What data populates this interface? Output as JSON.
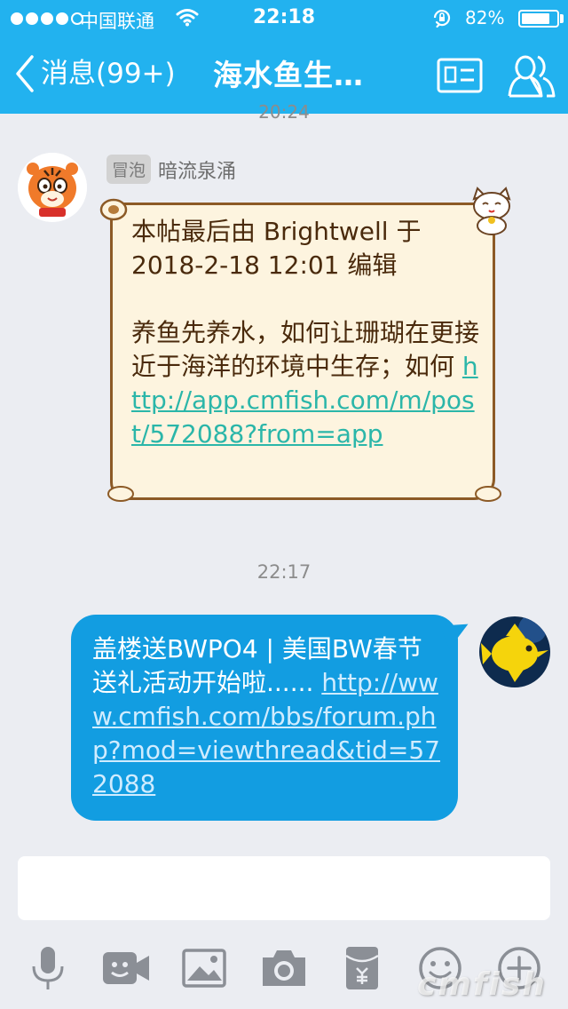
{
  "status_bar": {
    "carrier": "中国联通",
    "time": "22:18",
    "battery_pct": "82%",
    "battery_level": 0.82,
    "signal_filled": 4,
    "signal_total": 5
  },
  "nav": {
    "back_label": "消息(99+)",
    "title": "海水鱼生…",
    "icons": [
      "chevron-left-icon",
      "profile-card-icon",
      "group-members-icon"
    ]
  },
  "chat": {
    "partial_timestamp": "20:24",
    "incoming": {
      "sender_badge": "冒泡",
      "sender_name": "暗流泉涌",
      "avatar": "tiger-avatar",
      "line1": "本帖最后由 Brightwell 于 2018-2-18 12:01 编辑",
      "line2": "养鱼先养水，如何让珊瑚在更接近于海洋的环境中生存；如何",
      "link": "http://app.cmfish.com/m/post/572088?from=app"
    },
    "timestamp": "22:17",
    "outgoing": {
      "text": "盖楼送BWPO4 | 美国BW春节送礼活动开始啦......",
      "link": "http://www.cmfish.com/bbs/forum.php?mod=viewthread&tid=572088",
      "avatar": "yellow-fish-avatar"
    }
  },
  "input": {
    "placeholder": ""
  },
  "toolbar": {
    "items": [
      "microphone-icon",
      "video-call-icon",
      "image-icon",
      "camera-icon",
      "red-packet-icon",
      "emoji-icon",
      "plus-icon"
    ]
  },
  "watermark": "cmfish",
  "colors": {
    "header": "#22b2ef",
    "background": "#ebedf2",
    "outgoing_bubble": "#129de1",
    "incoming_bubble": "#fdf4df",
    "incoming_border": "#8c5a26"
  }
}
